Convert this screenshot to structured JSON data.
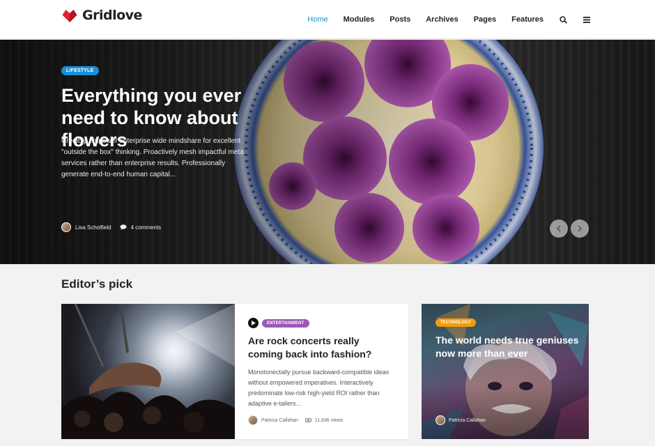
{
  "header": {
    "logo_text": "Gridlove",
    "brand_color": "#e2202f",
    "nav": [
      {
        "label": "Home",
        "active": true
      },
      {
        "label": "Modules"
      },
      {
        "label": "Posts"
      },
      {
        "label": "Archives"
      },
      {
        "label": "Pages"
      },
      {
        "label": "Features"
      }
    ],
    "icons": [
      "search-icon",
      "menu-icon"
    ]
  },
  "hero": {
    "category": "LIFESTYLE",
    "title": "Everything you ever need to know about flowers",
    "excerpt": "Credibly empower enterprise wide mindshare for excellent \"outside the box\" thinking. Proactively mesh impactful meta services rather than enterprise results. Professionally generate end-to-end human capital...",
    "author": "Lisa Scholfield",
    "comments": "4 comments",
    "accent": "#1c8fd6"
  },
  "editors_pick": {
    "heading": "Editor’s pick",
    "cards": [
      {
        "category": "ENTERTAINMENT",
        "title": "Are rock concerts really coming back into fashion?",
        "excerpt": "Monotonectally pursue backward-compatible ideas without empowered imperatives. Interactively predominate low-risk high-yield ROI rather than adaptive e-tailers...",
        "author": "Patricia Callahan",
        "views": "11,636 views",
        "category_color": "#9b59b6"
      },
      {
        "category": "TECHNOLOGY",
        "title": "The world needs true geniuses now more than ever",
        "author": "Patricia Callahan",
        "category_color": "#f39c12"
      }
    ]
  }
}
